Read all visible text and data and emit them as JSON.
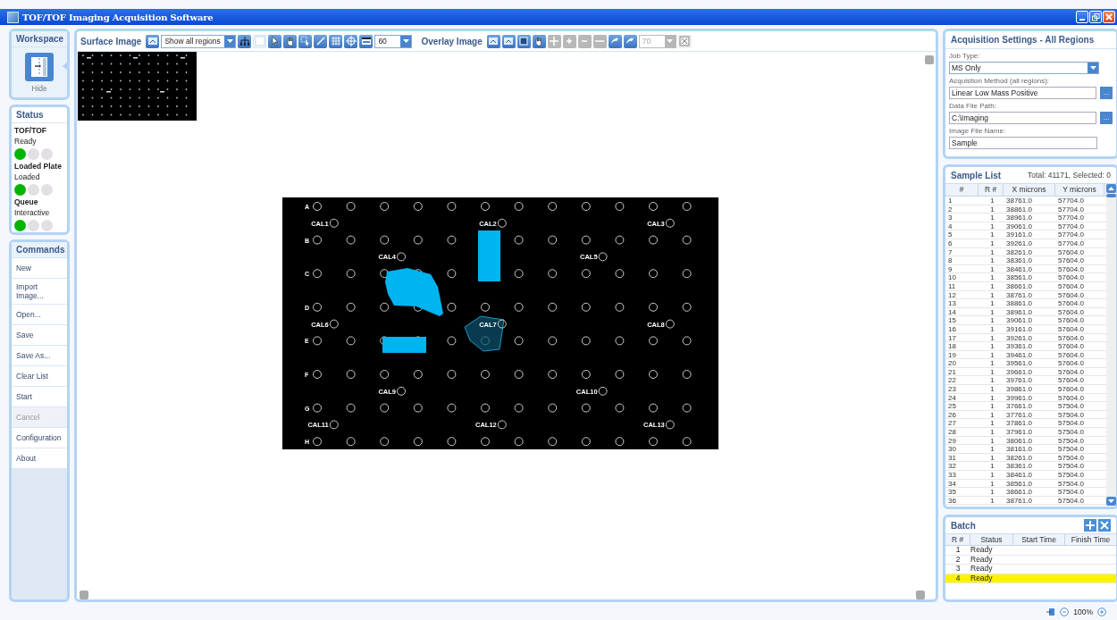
{
  "window": {
    "title": "TOF/TOF Imaging Acquisition Software"
  },
  "workspace": {
    "title": "Workspace",
    "hide_label": "Hide"
  },
  "status": {
    "title": "Status",
    "groups": [
      {
        "label": "TOF/TOF",
        "value": "Ready",
        "lights": [
          {
            "on": true
          },
          {
            "on": false
          },
          {
            "on": false
          }
        ]
      },
      {
        "label": "Loaded Plate",
        "value": "Loaded",
        "lights": [
          {
            "on": true
          },
          {
            "on": false
          },
          {
            "on": false
          }
        ]
      },
      {
        "label": "Queue",
        "value": "Interactive",
        "lights": [
          {
            "on": true
          },
          {
            "on": false
          },
          {
            "on": false
          }
        ]
      }
    ]
  },
  "commands": {
    "title": "Commands",
    "items": [
      {
        "label": "New",
        "disabled": false
      },
      {
        "label": "Import Image...",
        "disabled": false
      },
      {
        "label": "Open...",
        "disabled": false
      },
      {
        "label": "Save",
        "disabled": false
      },
      {
        "label": "Save As...",
        "disabled": false
      },
      {
        "label": "Clear List",
        "disabled": false
      },
      {
        "label": "Start",
        "disabled": false
      },
      {
        "label": "Cancel",
        "disabled": true
      },
      {
        "label": "Configuration",
        "disabled": false
      },
      {
        "label": "About",
        "disabled": false
      }
    ]
  },
  "surface_image": {
    "title": "Surface Image",
    "region_filter": "Show all regions",
    "zoom_value": "60"
  },
  "overlay_image": {
    "title": "Overlay Image",
    "opacity_value": "70",
    "disabled": true
  },
  "plate": {
    "row_labels": [
      "A",
      "B",
      "C",
      "D",
      "E",
      "F",
      "G",
      "H"
    ],
    "calibration_labels": [
      "CAL1",
      "CAL2",
      "CAL3",
      "CAL4",
      "CAL5",
      "CAL6",
      "CAL7",
      "CAL8",
      "CAL9",
      "CAL10",
      "CAL11",
      "CAL12",
      "CAL13"
    ]
  },
  "acquisition_settings": {
    "title": "Acquisition Settings - All Regions",
    "fields": [
      {
        "kind": "select",
        "label": "Job Type:",
        "value": "MS Only"
      },
      {
        "kind": "browse",
        "label": "Acquistion Method (all regions):",
        "value": "Linear Low Mass Positive",
        "button": "..."
      },
      {
        "kind": "browse",
        "label": "Data File Path:",
        "value": "C:\\Imaging",
        "button": "..."
      },
      {
        "kind": "text",
        "label": "Image File Name:",
        "value": "Sample"
      }
    ]
  },
  "sample_list": {
    "title": "Sample List",
    "summary": "Total: 41171, Selected: 0",
    "columns": [
      "#",
      "R #",
      "X microns",
      "Y microns"
    ],
    "rows": [
      [
        "1",
        "1",
        "38761.0",
        "57704.0"
      ],
      [
        "2",
        "1",
        "38861.0",
        "57704.0"
      ],
      [
        "3",
        "1",
        "38961.0",
        "57704.0"
      ],
      [
        "4",
        "1",
        "39061.0",
        "57704.0"
      ],
      [
        "5",
        "1",
        "39161.0",
        "57704.0"
      ],
      [
        "6",
        "1",
        "39261.0",
        "57704.0"
      ],
      [
        "7",
        "1",
        "38261.0",
        "57604.0"
      ],
      [
        "8",
        "1",
        "38361.0",
        "57604.0"
      ],
      [
        "9",
        "1",
        "38461.0",
        "57604.0"
      ],
      [
        "10",
        "1",
        "38561.0",
        "57604.0"
      ],
      [
        "11",
        "1",
        "38661.0",
        "57604.0"
      ],
      [
        "12",
        "1",
        "38761.0",
        "57604.0"
      ],
      [
        "13",
        "1",
        "38861.0",
        "57604.0"
      ],
      [
        "14",
        "1",
        "38961.0",
        "57604.0"
      ],
      [
        "15",
        "1",
        "39061.0",
        "57604.0"
      ],
      [
        "16",
        "1",
        "39161.0",
        "57604.0"
      ],
      [
        "17",
        "1",
        "39261.0",
        "57604.0"
      ],
      [
        "18",
        "1",
        "39361.0",
        "57604.0"
      ],
      [
        "19",
        "1",
        "39461.0",
        "57604.0"
      ],
      [
        "20",
        "1",
        "39561.0",
        "57604.0"
      ],
      [
        "21",
        "1",
        "39661.0",
        "57604.0"
      ],
      [
        "22",
        "1",
        "39761.0",
        "57604.0"
      ],
      [
        "23",
        "1",
        "39861.0",
        "57604.0"
      ],
      [
        "24",
        "1",
        "39961.0",
        "57604.0"
      ],
      [
        "25",
        "1",
        "37661.0",
        "57504.0"
      ],
      [
        "26",
        "1",
        "37761.0",
        "57504.0"
      ],
      [
        "27",
        "1",
        "37861.0",
        "57504.0"
      ],
      [
        "28",
        "1",
        "37961.0",
        "57504.0"
      ],
      [
        "29",
        "1",
        "38061.0",
        "57504.0"
      ],
      [
        "30",
        "1",
        "38161.0",
        "57504.0"
      ],
      [
        "31",
        "1",
        "38261.0",
        "57504.0"
      ],
      [
        "32",
        "1",
        "38361.0",
        "57504.0"
      ],
      [
        "33",
        "1",
        "38461.0",
        "57504.0"
      ],
      [
        "34",
        "1",
        "38561.0",
        "57504.0"
      ],
      [
        "35",
        "1",
        "38661.0",
        "57504.0"
      ],
      [
        "36",
        "1",
        "38761.0",
        "57504.0"
      ]
    ]
  },
  "batch": {
    "title": "Batch",
    "columns": [
      "R #",
      "Status",
      "Start Time",
      "Finish Time"
    ],
    "rows": [
      {
        "r": "1",
        "status": "Ready",
        "selected": false
      },
      {
        "r": "2",
        "status": "Ready",
        "selected": false
      },
      {
        "r": "3",
        "status": "Ready",
        "selected": false
      },
      {
        "r": "4",
        "status": "Ready",
        "selected": true
      }
    ]
  },
  "status_bar": {
    "zoom": "100%"
  }
}
